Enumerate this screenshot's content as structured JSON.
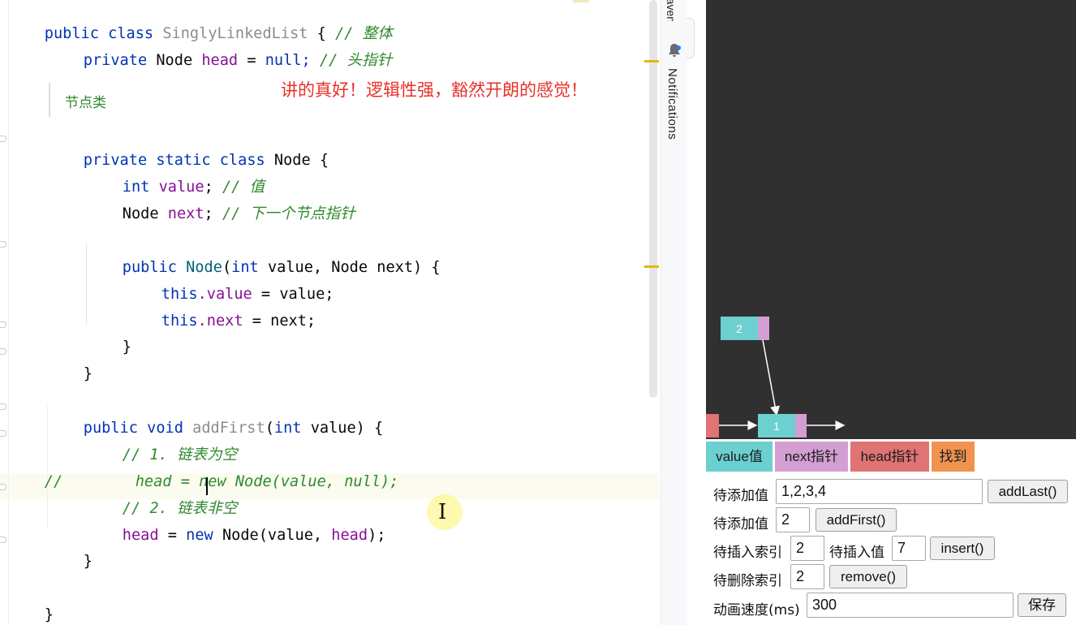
{
  "editor": {
    "lines": {
      "l1": {
        "kw1": "public",
        "kw2": "class",
        "name": "SinglyLinkedList",
        "brace": "{",
        "comment": "// 整体"
      },
      "l2": {
        "kw": "private",
        "type": "Node",
        "field": "head",
        "eq": "=",
        "val": "null;",
        "comment": "// 头指针"
      },
      "l5": {
        "kw1": "private",
        "kw2": "static",
        "kw3": "class",
        "name": "Node",
        "brace": "{"
      },
      "l6": {
        "kw": "int",
        "field": "value",
        "semi": ";",
        "comment": "// 值"
      },
      "l7": {
        "type": "Node",
        "field": "next",
        "semi": ";",
        "comment": "// 下一个节点指针"
      },
      "l9": {
        "kw": "public",
        "ctor": "Node",
        "params_open": "(",
        "kw_int": "int",
        "p1": "value, Node next) {"
      },
      "l10": {
        "kw": "this",
        "field": ".value",
        "rest": " = value;"
      },
      "l11": {
        "kw": "this",
        "field": ".next",
        "rest": " = next;"
      },
      "l12": {
        "brace": "}"
      },
      "l13": {
        "brace": "}"
      },
      "l15": {
        "kw1": "public",
        "kw2": "void",
        "name": "addFirst",
        "open": "(",
        "kw_int": "int",
        "rest": " value) {"
      },
      "l16": {
        "comment": "// 1. 链表为空"
      },
      "l17": {
        "comment": "//        head = new Node(value, null);"
      },
      "l18": {
        "comment": "// 2. 链表非空"
      },
      "l19": {
        "field1": "head",
        "eq": " = ",
        "kw": "new",
        "rest1": " Node(value, ",
        "field2": "head",
        "rest2": ");"
      },
      "l20": {
        "brace": "}"
      },
      "l22": {
        "brace": "}"
      }
    },
    "inlay_hint": "节点类",
    "danmaku": "讲的真好！逻辑性强，豁然开朗的感觉！"
  },
  "toolstrip": {
    "maven_label": "Maven",
    "notifications_label": "Notifications",
    "bell_icon": "bell-icon"
  },
  "visualizer": {
    "nodes": [
      {
        "value": "2"
      },
      {
        "value": "1"
      }
    ],
    "legend": {
      "value": "value值",
      "next": "next指针",
      "head": "head指针",
      "found": "找到"
    },
    "colors": {
      "value": "#6ccfd0",
      "next": "#d39fd3",
      "head": "#e07373",
      "found": "#f0934f",
      "canvas": "#303030"
    },
    "controls": {
      "add_last_label": "待添加值",
      "add_last_value": "1,2,3,4",
      "add_last_button": "addLast()",
      "add_first_label": "待添加值",
      "add_first_value": "2",
      "add_first_button": "addFirst()",
      "insert_index_label": "待插入索引",
      "insert_index_value": "2",
      "insert_value_label": "待插入值",
      "insert_value_value": "7",
      "insert_button": "insert()",
      "remove_label": "待删除索引",
      "remove_value": "2",
      "remove_button": "remove()",
      "speed_label": "动画速度(ms)",
      "speed_value": "300",
      "save_button": "保存"
    }
  }
}
